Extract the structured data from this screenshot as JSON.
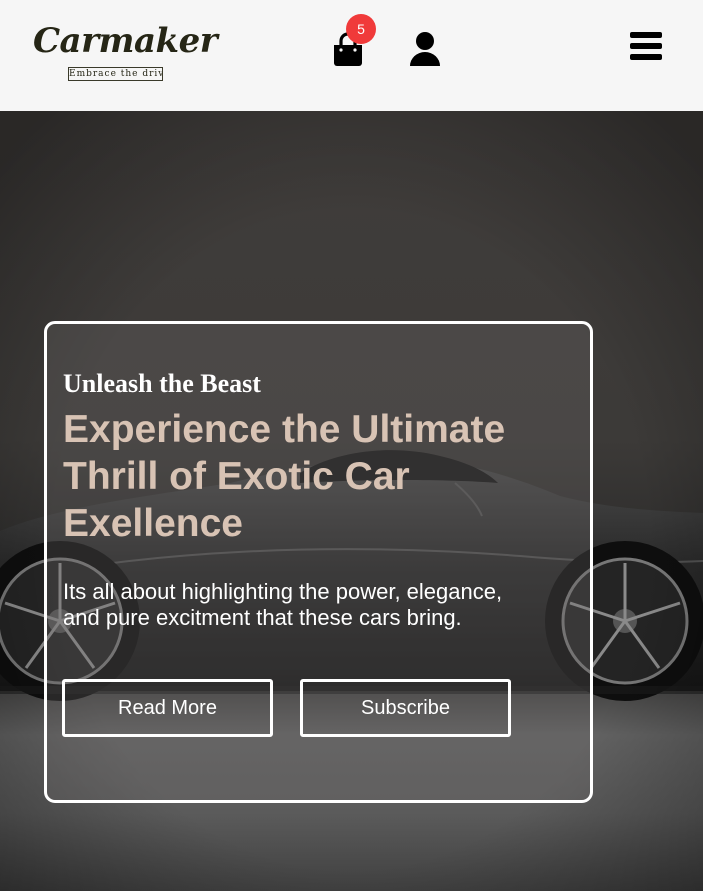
{
  "brand": {
    "name": "Carmaker",
    "tagline": "Embrace the drive"
  },
  "header": {
    "cart_count": "5",
    "icons": {
      "cart": "shopping-bag-icon",
      "account": "user-icon",
      "menu": "hamburger-menu-icon"
    }
  },
  "hero": {
    "kicker": "Unleash the Beast",
    "headline": "Experience the Ultimate Thrill of Exotic Car Exellence",
    "blurb": "Its all about highlighting the power, elegance, and pure excitment that these cars bring.",
    "buttons": {
      "read_more": "Read More",
      "subscribe": "Subscribe"
    }
  },
  "colors": {
    "header_bg": "#f6f6f6",
    "logo_text": "#262616",
    "badge": "#f03a3a",
    "headline": "#d8c3b4",
    "hero_text": "#ffffff"
  }
}
